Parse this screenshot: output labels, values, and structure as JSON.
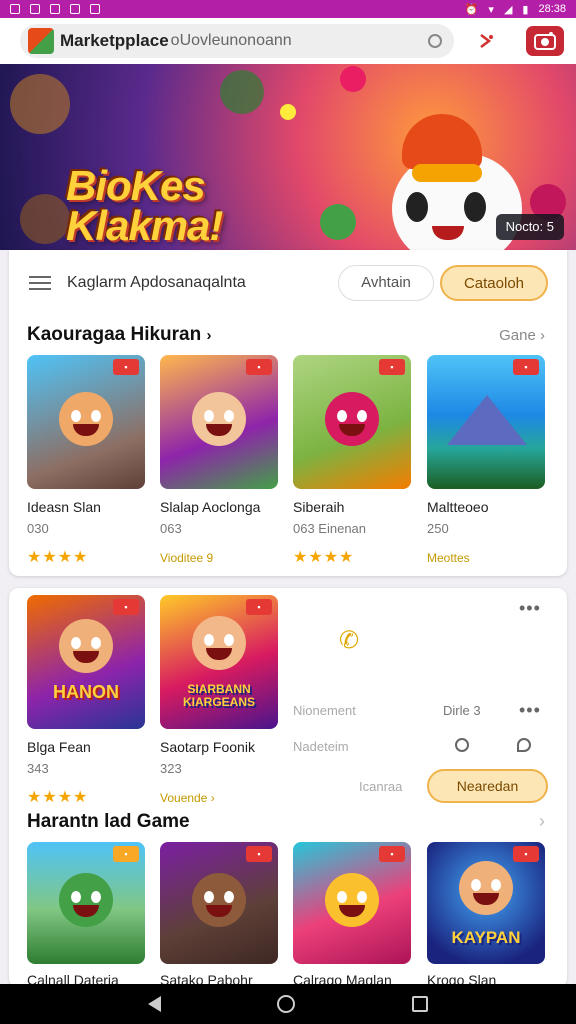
{
  "status_bar": {
    "time": "28:38"
  },
  "app_bar": {
    "title": "Marketpplace",
    "search_placeholder": "oUovleunonoann"
  },
  "banner": {
    "title_line1": "BioKes",
    "title_line2": "Klakma!",
    "badge": "Nocto: 5"
  },
  "filter_bar": {
    "label": "Kaglarm Apdosanaqalnta",
    "pill_outline": "Avhtain",
    "pill_filled": "Cataoloh"
  },
  "section1": {
    "title": "Kaouragaa Hikuran",
    "link": "Gane",
    "items": [
      {
        "title": "Ideasn Slan",
        "meta": "030",
        "rating": "★★★★"
      },
      {
        "title": "Slalap Aoclonga",
        "meta": "063",
        "link": "Vioditee 9"
      },
      {
        "title": "Siberaih",
        "meta": "063 Einenan",
        "rating": "★★★★"
      },
      {
        "title": "Maltteoeo",
        "meta": "250",
        "link": "Meottes"
      }
    ]
  },
  "section2": {
    "items": [
      {
        "title": "Blga Fean",
        "meta": "343",
        "rating": "★★★★",
        "tile_word": "HANON"
      },
      {
        "title": "Saotarp Foonik",
        "meta": "323",
        "link": "Vouende",
        "tile_word": "SIARBANN KIARGEANS"
      }
    ],
    "side": {
      "label1": "Nionement",
      "label1_right": "Dirle 3",
      "label2": "Nadeteim",
      "label3": "Icanraa",
      "button": "Nearedan"
    }
  },
  "section3": {
    "title": "Harantn lad Game",
    "items": [
      {
        "title": "Calnall Dateria"
      },
      {
        "title": "Satako Pabohr"
      },
      {
        "title": "Calrago Maglan"
      },
      {
        "title": "Krogo Slan",
        "tile_word": "KAYPAN"
      }
    ]
  }
}
